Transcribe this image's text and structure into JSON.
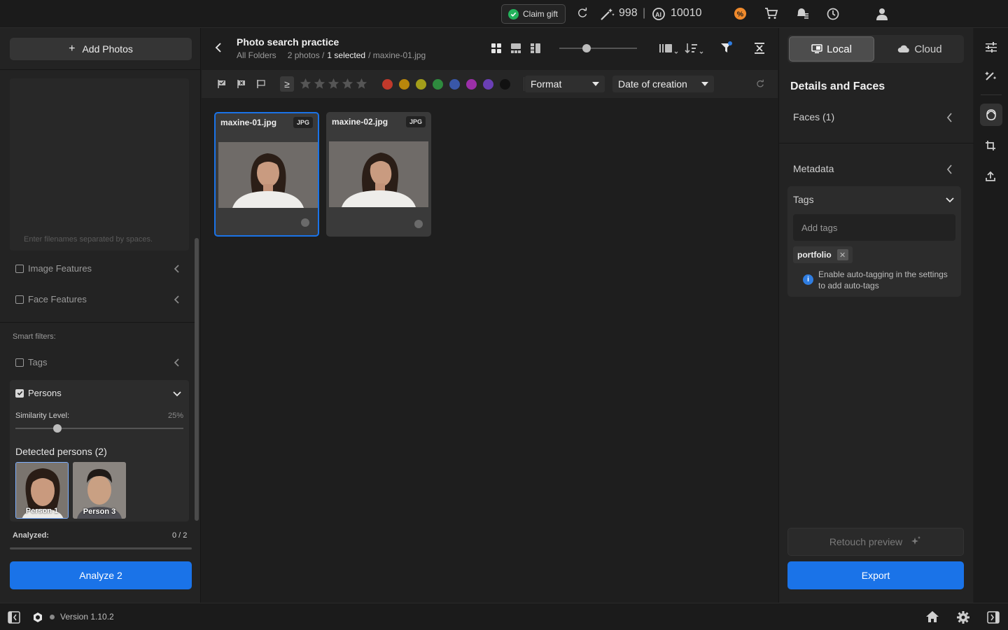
{
  "topbar": {
    "claim_gift": "Claim gift",
    "credits_magic": "998",
    "credits_sep": "|",
    "credits_ai": "10010"
  },
  "left": {
    "add_photos": "Add Photos",
    "search_placeholder": "Enter filenames separated by spaces.",
    "image_features": "Image Features",
    "face_features": "Face Features",
    "smart_filters": "Smart filters:",
    "tags": "Tags",
    "persons": "Persons",
    "similarity_label": "Similarity Level:",
    "similarity_value": "25%",
    "similarity_fraction": 0.25,
    "detected_persons": "Detected persons (2)",
    "person_labels": [
      "Person 1",
      "Person 3"
    ],
    "analyzed_label": "Analyzed:",
    "analyzed_value": "0 / 2",
    "analyze_button": "Analyze 2"
  },
  "center": {
    "title": "Photo search practice",
    "breadcrumb_folder": "All Folders",
    "breadcrumb_count": "2 photos /",
    "breadcrumb_selected": "1 selected",
    "breadcrumb_file": "/ maxine-01.jpg",
    "rating_operator": "≥",
    "format_dropdown": "Format",
    "date_dropdown": "Date of creation",
    "color_labels": [
      "#c0392b",
      "#b8860b",
      "#a39e1a",
      "#2e8b3e",
      "#3957a8",
      "#9b2fa8",
      "#6a3fb5",
      "#111111"
    ],
    "photos": [
      {
        "name": "maxine-01.jpg",
        "format": "JPG",
        "selected": true
      },
      {
        "name": "maxine-02.jpg",
        "format": "JPG",
        "selected": false
      }
    ]
  },
  "right": {
    "local": "Local",
    "cloud": "Cloud",
    "section_title": "Details and Faces",
    "faces": "Faces (1)",
    "metadata": "Metadata",
    "tags": "Tags",
    "add_tags_placeholder": "Add tags",
    "tag_chip": "portfolio",
    "tag_remove": "✕",
    "info_text": "Enable auto-tagging in the settings to add auto-tags",
    "retouch_preview": "Retouch preview",
    "export": "Export"
  },
  "bottom": {
    "version": "Version 1.10.2"
  }
}
